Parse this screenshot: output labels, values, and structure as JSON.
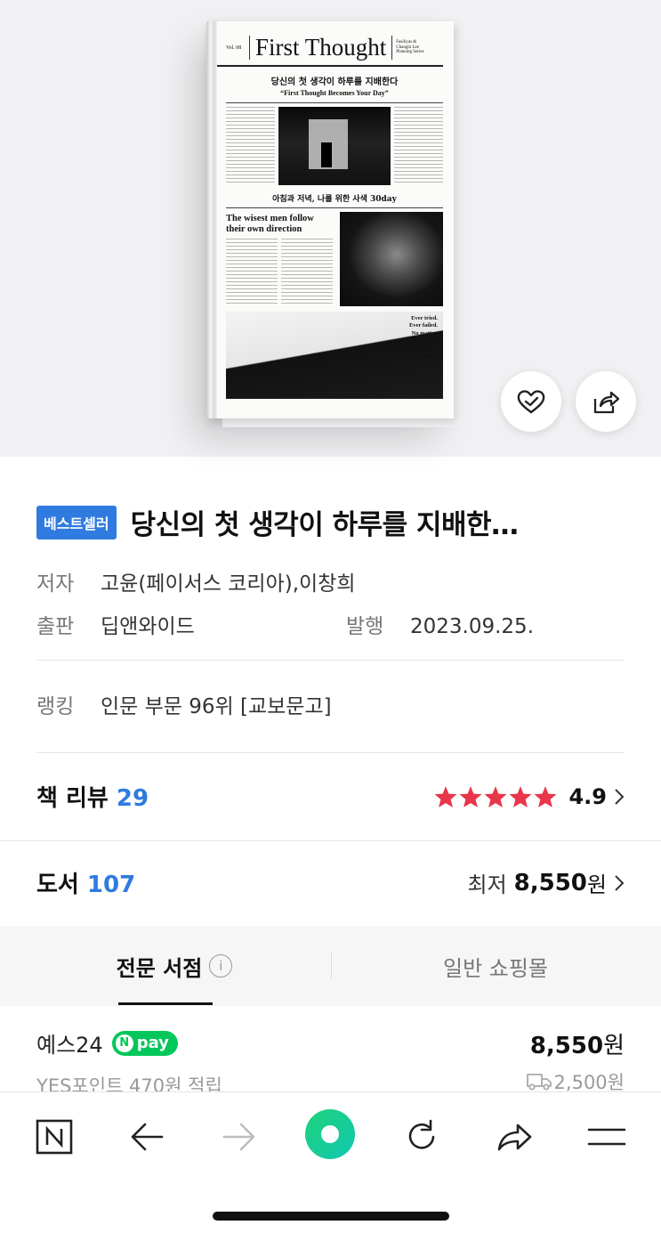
{
  "book_cover": {
    "vol": "Vol. 08",
    "masthead": "First Thought",
    "side_note": "Fasiliyas & Changhi Lee Planning Series",
    "subtitle_kr": "당신의 첫 생각이 하루를 지배한다",
    "subtitle_en": "“First Thought Becomes Your Day”",
    "mid_heading": "아침과 저녁, 나를 위한 사색 30day",
    "headline": "The wisest men follow their own direction",
    "quote": [
      "Ever tried.",
      "Ever failed.",
      "No matter.",
      "Try Again.",
      "Fail again.",
      "Fail better."
    ]
  },
  "actions": {
    "wish_icon": "heart-check-icon",
    "share_icon": "share-icon"
  },
  "badge": "베스트셀러",
  "title": "당신의 첫 생각이 하루를 지배한…",
  "author": {
    "label": "저자",
    "value": "고윤(페이서스 코리아),이창희"
  },
  "publisher": {
    "label": "출판",
    "value": "딥앤와이드"
  },
  "published": {
    "label": "발행",
    "value": "2023.09.25."
  },
  "ranking": {
    "label": "랭킹",
    "value": "인문 부문 96위 [교보문고]"
  },
  "review": {
    "label": "책 리뷰",
    "count": "29",
    "rating": "4.9",
    "stars": 5,
    "star_color": "#e8364a"
  },
  "books": {
    "label": "도서",
    "count": "107",
    "lowest_label": "최저",
    "lowest_price": "8,550",
    "won": "원"
  },
  "tabs": [
    {
      "label": "전문 서점",
      "active": true
    },
    {
      "label": "일반 쇼핑몰",
      "active": false
    }
  ],
  "info_icon": "i",
  "shop": {
    "name": "예스24",
    "npay_label": "pay",
    "npay_n": "N",
    "price": "8,550",
    "won": "원",
    "points": "YES포인트 470원 적립",
    "shipping": "2,500원"
  },
  "bottom_nav": [
    "naver-home-icon",
    "back-arrow-icon",
    "forward-arrow-icon",
    "green-dot-icon",
    "refresh-icon",
    "share-arrow-icon",
    "menu-icon"
  ],
  "colors": {
    "accent": "#2f7be0",
    "naver_green": "#03c75a"
  }
}
